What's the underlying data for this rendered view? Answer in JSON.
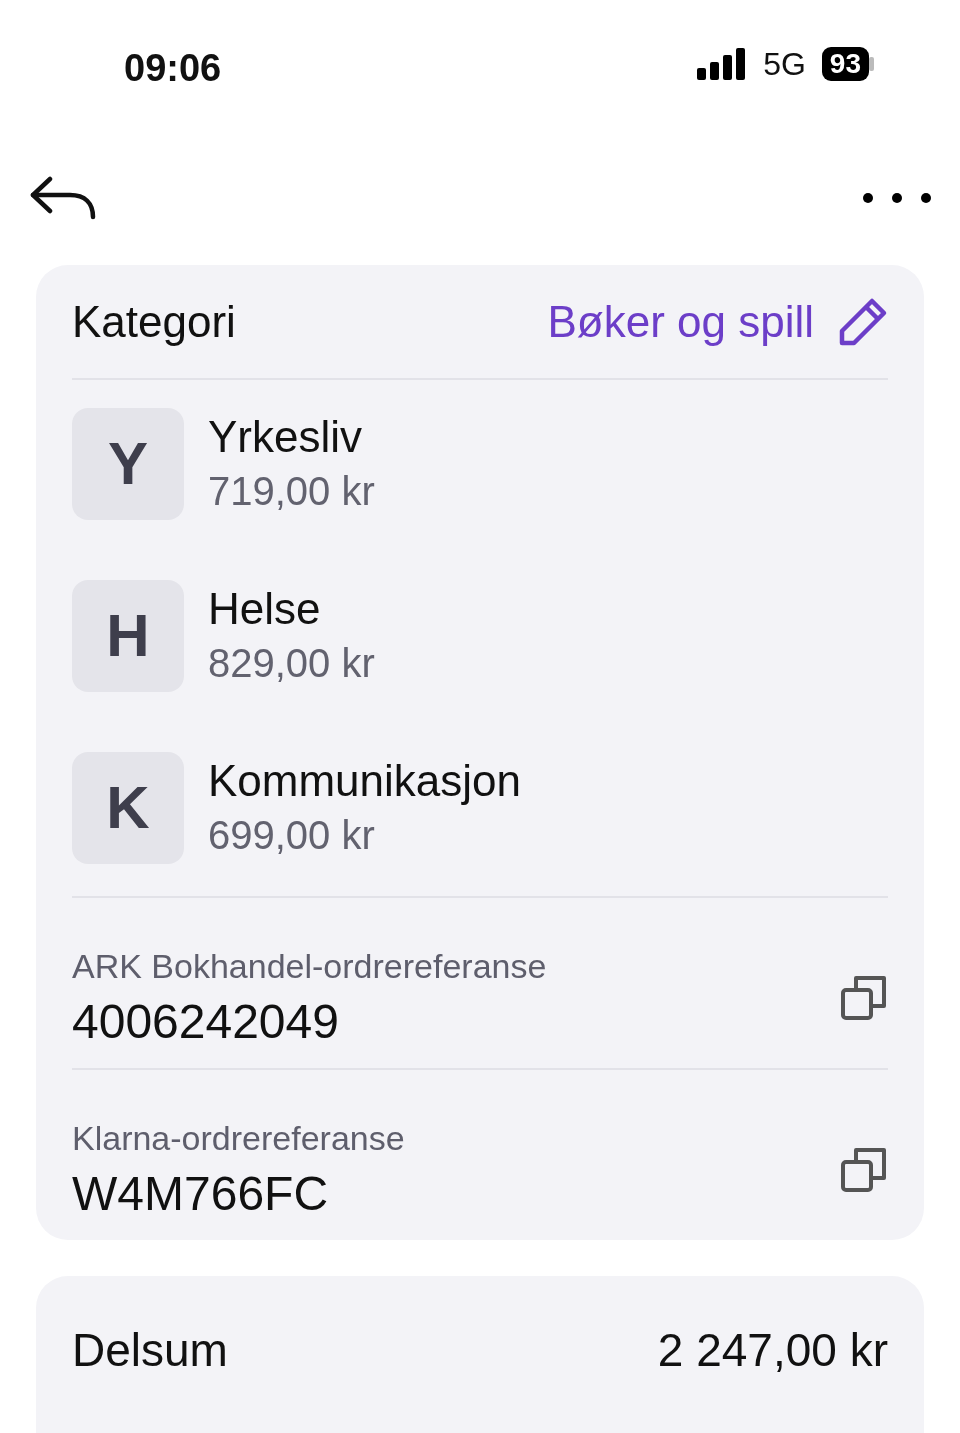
{
  "status_bar": {
    "time": "09:06",
    "network": "5G",
    "battery": "93"
  },
  "category": {
    "label": "Kategori",
    "value": "Bøker og spill"
  },
  "items": [
    {
      "initial": "Y",
      "name": "Yrkesliv",
      "amount": "719,00 kr"
    },
    {
      "initial": "H",
      "name": "Helse",
      "amount": "829,00 kr"
    },
    {
      "initial": "K",
      "name": "Kommunikasjon",
      "amount": "699,00 kr"
    }
  ],
  "references": [
    {
      "label": "ARK Bokhandel-ordrereferanse",
      "value": "4006242049"
    },
    {
      "label": "Klarna-ordrereferanse",
      "value": "W4M766FC"
    }
  ],
  "summary": [
    {
      "label": "Delsum",
      "value": "2 247,00 kr"
    }
  ]
}
